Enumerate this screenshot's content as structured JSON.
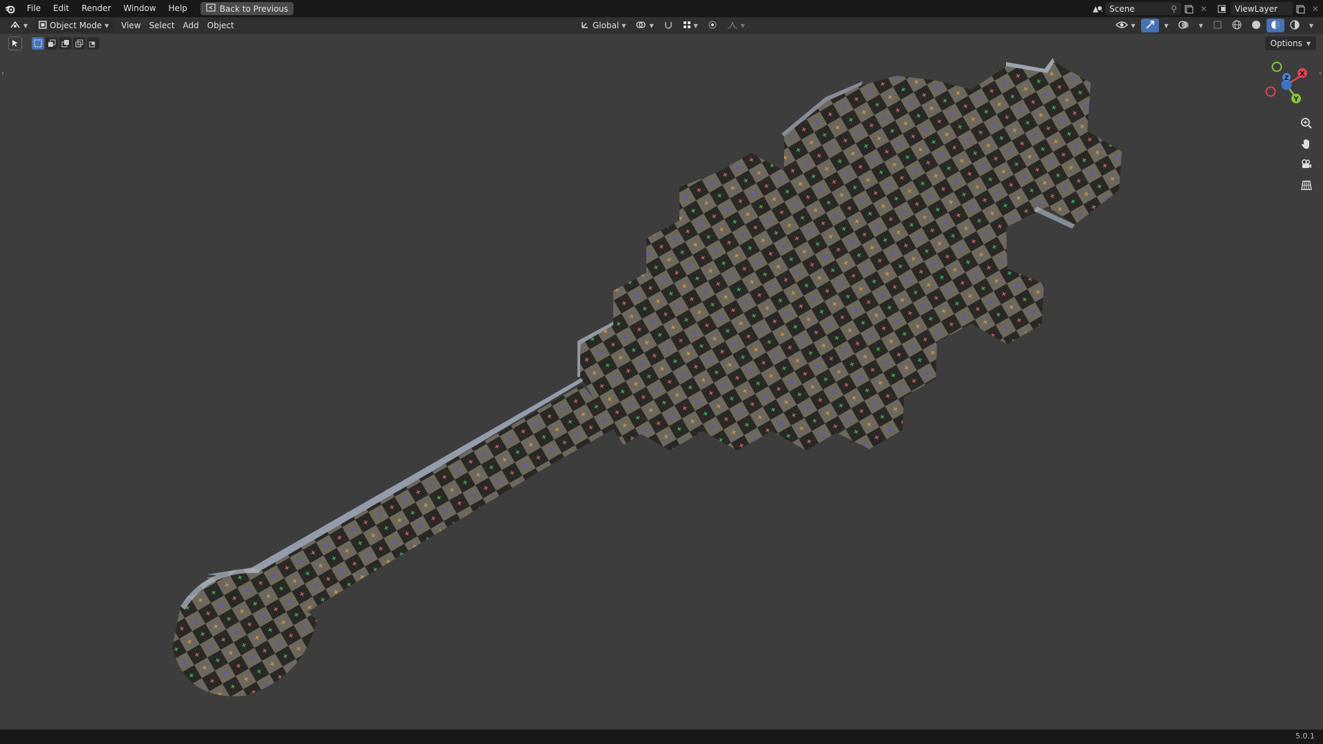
{
  "menubar": {
    "items": [
      "File",
      "Edit",
      "Render",
      "Window",
      "Help"
    ],
    "back_button": "Back to Previous",
    "scene_name": "Scene",
    "view_layer_name": "ViewLayer"
  },
  "viewport_header": {
    "mode": "Object Mode",
    "menus": [
      "View",
      "Select",
      "Add",
      "Object"
    ],
    "transform_orientation": "Global"
  },
  "viewport": {
    "options_label": "Options",
    "gizmo_axes": [
      "X",
      "Y",
      "Z"
    ],
    "object": "checker-textured key-shaped mesh"
  },
  "statusbar": {
    "version": "5.0.1"
  },
  "colors": {
    "background": "#3d3d3d",
    "menubar": "#181818",
    "header": "#303030",
    "accent": "#4772b3",
    "axis_x": "#e04456",
    "axis_y": "#8bc43f",
    "axis_z": "#4f86d4",
    "checker_light": "#6f6a60",
    "checker_dark": "#2b2925"
  }
}
